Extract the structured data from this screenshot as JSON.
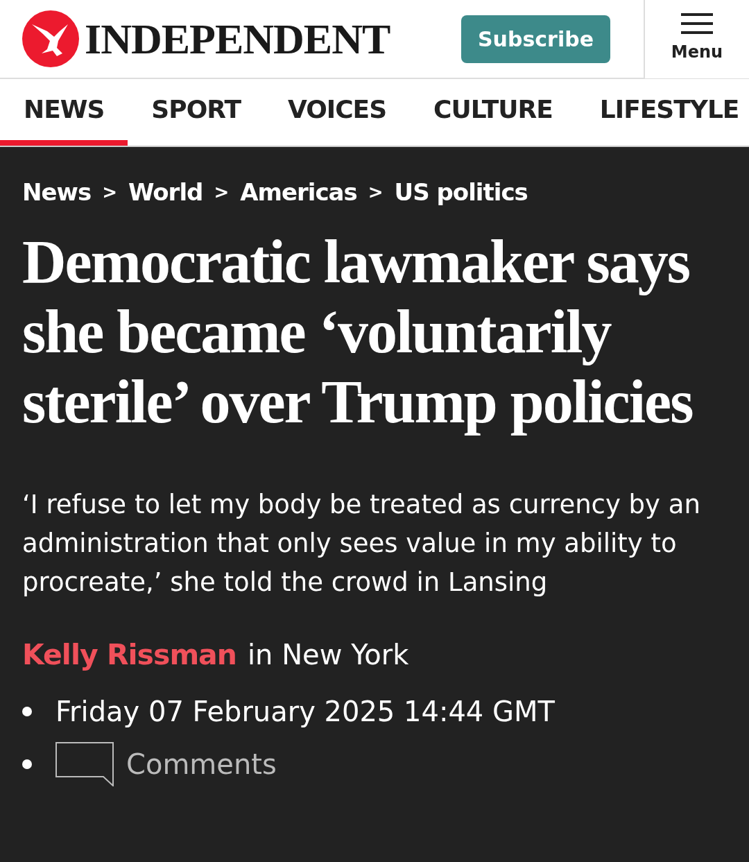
{
  "masthead": {
    "logo_text": "INDEPENDENT",
    "subscribe": "Subscribe",
    "menu": "Menu"
  },
  "nav": [
    {
      "label": "NEWS",
      "selected": true
    },
    {
      "label": "SPORT",
      "selected": false
    },
    {
      "label": "VOICES",
      "selected": false
    },
    {
      "label": "CULTURE",
      "selected": false
    },
    {
      "label": "LIFESTYLE",
      "selected": false
    }
  ],
  "breadcrumbs": [
    "News",
    "World",
    "Americas",
    "US politics"
  ],
  "breadcrumb_separator": ">",
  "headline": "Democratic lawmaker says she became ‘voluntarily sterile’ over Trump policies",
  "standfirst": "‘I refuse to let my body be treated as currency by an administration that only sees value in my ability to procreate,’ she told the crowd in Lansing",
  "byline": {
    "author": "Kelly Rissman",
    "location": "in New York"
  },
  "meta": [
    {
      "kind": "date",
      "text": "Friday 07 February 2025 14:44 GMT"
    },
    {
      "kind": "comments",
      "text": "Comments"
    }
  ]
}
